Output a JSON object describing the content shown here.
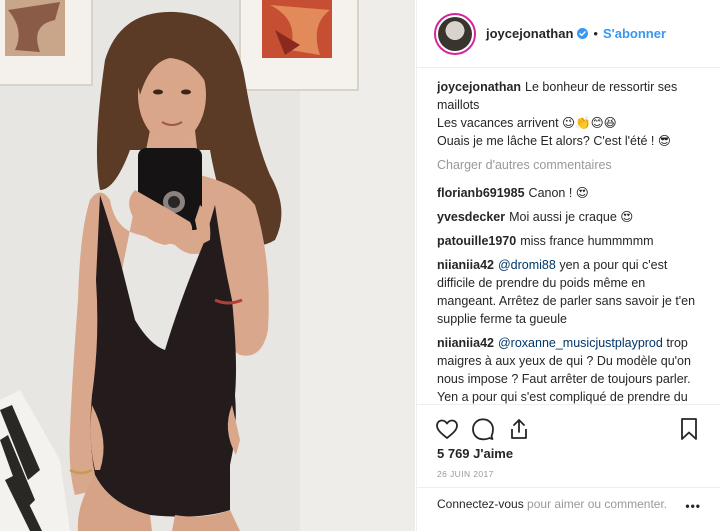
{
  "header": {
    "username": "joycejonathan",
    "separator": "•",
    "follow_label": "S'abonner"
  },
  "caption": {
    "username": "joycejonathan",
    "text": "Le bonheur de ressortir ses maillots\nLes vacances arrivent 😉👏😊😆\nOuais je me lâche Et alors? C'est l'été ! 😎"
  },
  "load_more_label": "Charger d'autres commentaires",
  "comments": [
    {
      "username": "florianb691985",
      "text": "Canon ! 😍"
    },
    {
      "username": "yvesdecker",
      "text": "Moi aussi je craque 😍"
    },
    {
      "username": "patouille1970",
      "text": "miss france hummmmm"
    },
    {
      "username": "niianiia42",
      "mention": "@dromi88",
      "text": "yen a pour qui c'est difficile de prendre du poids même en mangeant. Arrêtez de parler sans savoir je t'en supplie ferme ta gueule"
    },
    {
      "username": "niianiia42",
      "mention": "@roxanne_musicjustplayprod",
      "text": "trop maigres à aux yeux de qui ? Du modèle qu'on nous impose ? Faut arrêter de toujours parler. Yen a pour qui s'est compliqué de prendre du poids. Tu dirais à une Nana \"trop grosse dommage\" fermez"
    }
  ],
  "likes_label": "5 769 J'aime",
  "date_label": "26 JUIN 2017",
  "footer": {
    "login_label": "Connectez-vous",
    "rest_label": " pour aimer ou commenter.",
    "more_label": "•••"
  },
  "icons": {
    "verified": "verified-badge-icon",
    "like": "heart-icon",
    "comment": "comment-bubble-icon",
    "share": "share-icon",
    "save": "bookmark-icon"
  },
  "colors": {
    "link": "#3897f0",
    "muted": "#999999",
    "text": "#262626",
    "mention": "#003569"
  }
}
